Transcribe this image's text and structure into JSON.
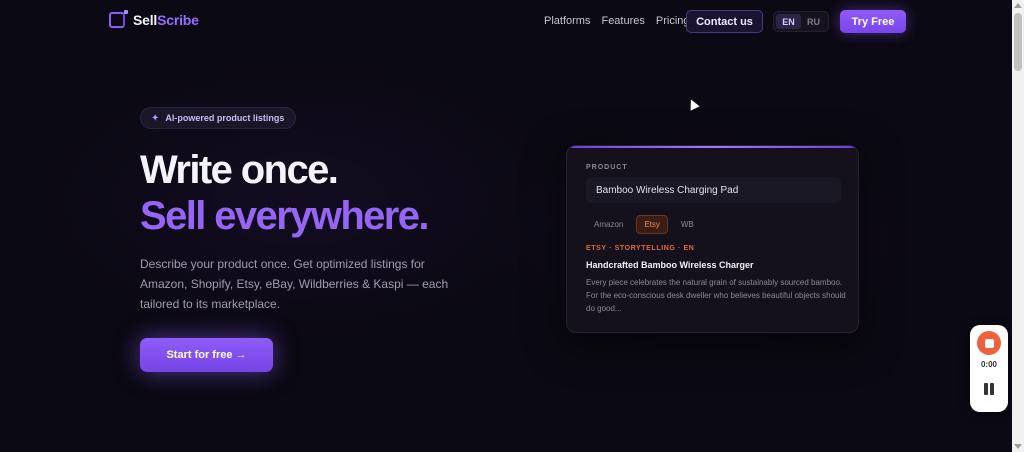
{
  "brand": {
    "part1": "Sell",
    "part2": "Scribe",
    "accent": "#9b6bff"
  },
  "nav": {
    "items": [
      "Platforms",
      "Features",
      "Pricing"
    ],
    "contact_label": "Contact us",
    "try_label": "Try Free"
  },
  "lang": {
    "options": [
      "EN",
      "RU"
    ],
    "selected": "EN"
  },
  "hero": {
    "badge": "AI-powered product listings",
    "headline_line1": "Write once.",
    "headline_line2": "Sell everywhere.",
    "description": "Describe your product once. Get optimized listings for Amazon, Shopify, Etsy, eBay, Wildberries & Kaspi — each tailored to its marketplace.",
    "cta_label": "Start for free →"
  },
  "card": {
    "label": "PRODUCT",
    "product_value": "Bamboo Wireless Charging Pad",
    "tabs": [
      "Amazon",
      "Etsy",
      "WB"
    ],
    "active_tab": "Etsy",
    "meta": "ETSY · STORYTELLING · EN",
    "title": "Handcrafted Bamboo Wireless Charger",
    "body": "Every piece celebrates the natural grain of sustainably sourced bamboo. For the eco-conscious desk dweller who believes beautiful objects should do good..."
  },
  "recorder": {
    "time": "0:00"
  }
}
